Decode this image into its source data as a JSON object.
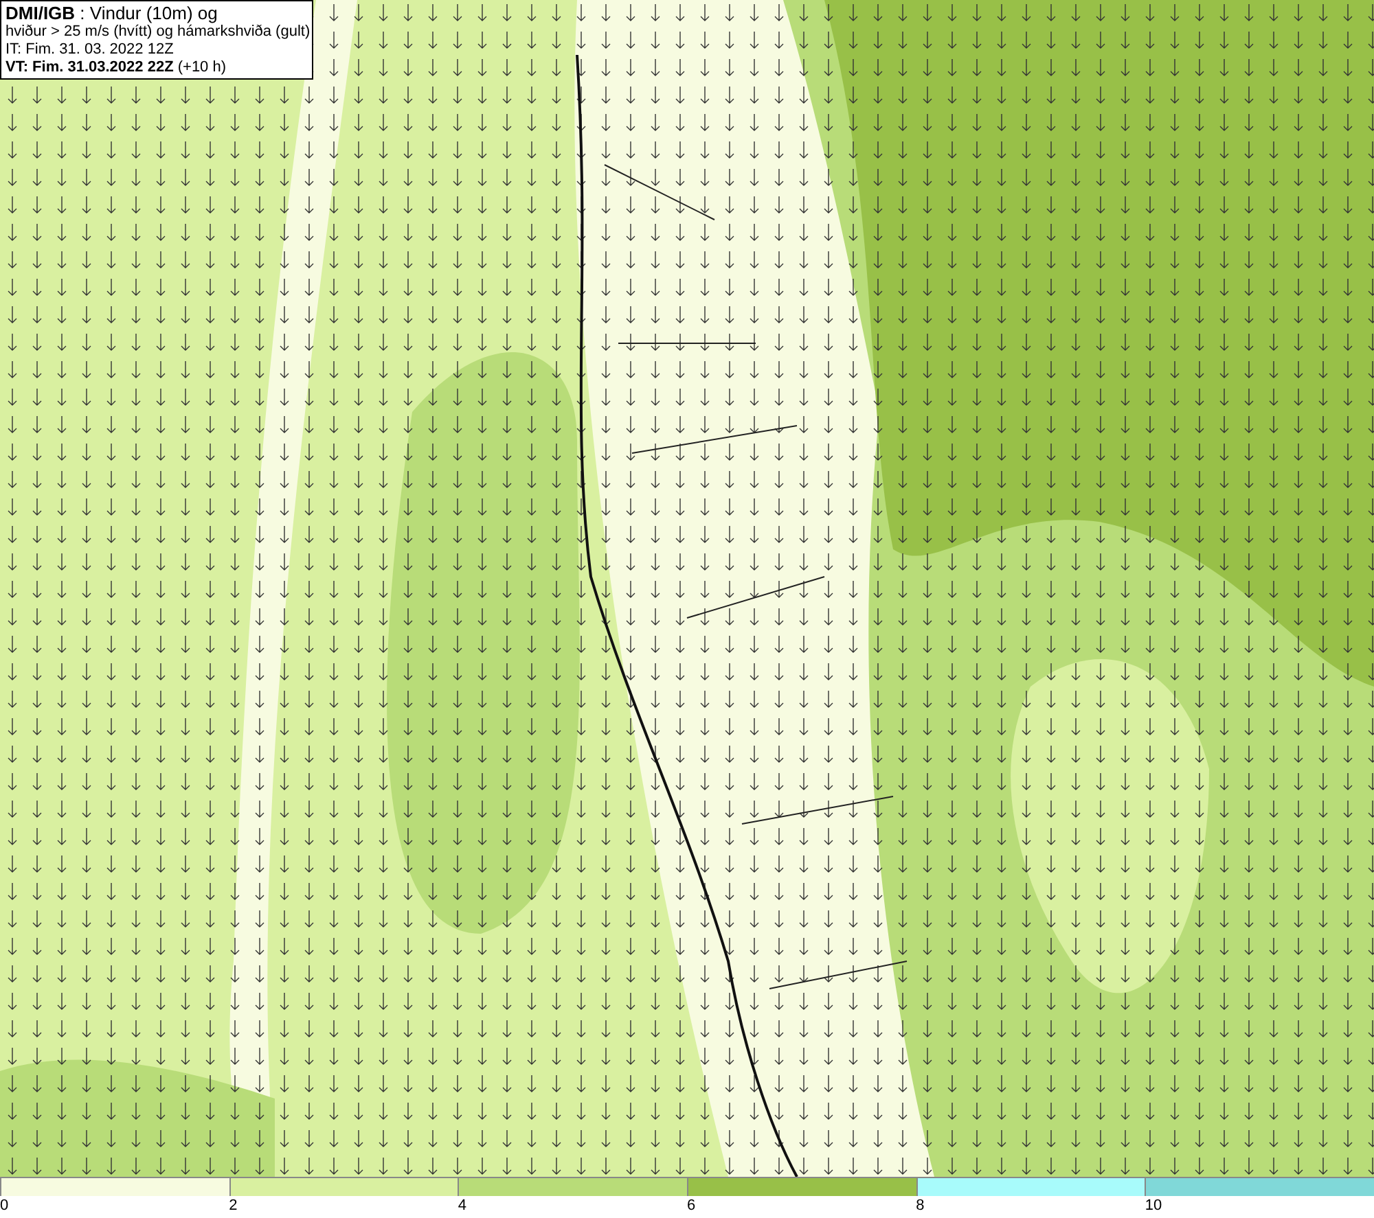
{
  "title_box": {
    "lines": [
      "**DMI/IGB** : Vindur (10m) og",
      "hviður > 25 m/s (hvítt) og hámarkshviða (gult)",
      "IT: Fim. 31. 03. 2022 12Z",
      "**VT: Fim. 31.03.2022 22Z** (+10 h)"
    ]
  },
  "legend": {
    "bins": [
      {
        "label": "0",
        "color": "#f7fbe0"
      },
      {
        "label": "2",
        "color": "#d9f0a0"
      },
      {
        "label": "4",
        "color": "#b8dc78"
      },
      {
        "label": "6",
        "color": "#98c048"
      },
      {
        "label": "8",
        "color": "#a8fbfb"
      },
      {
        "label": "10",
        "color": "#80d8d8"
      }
    ]
  }
}
